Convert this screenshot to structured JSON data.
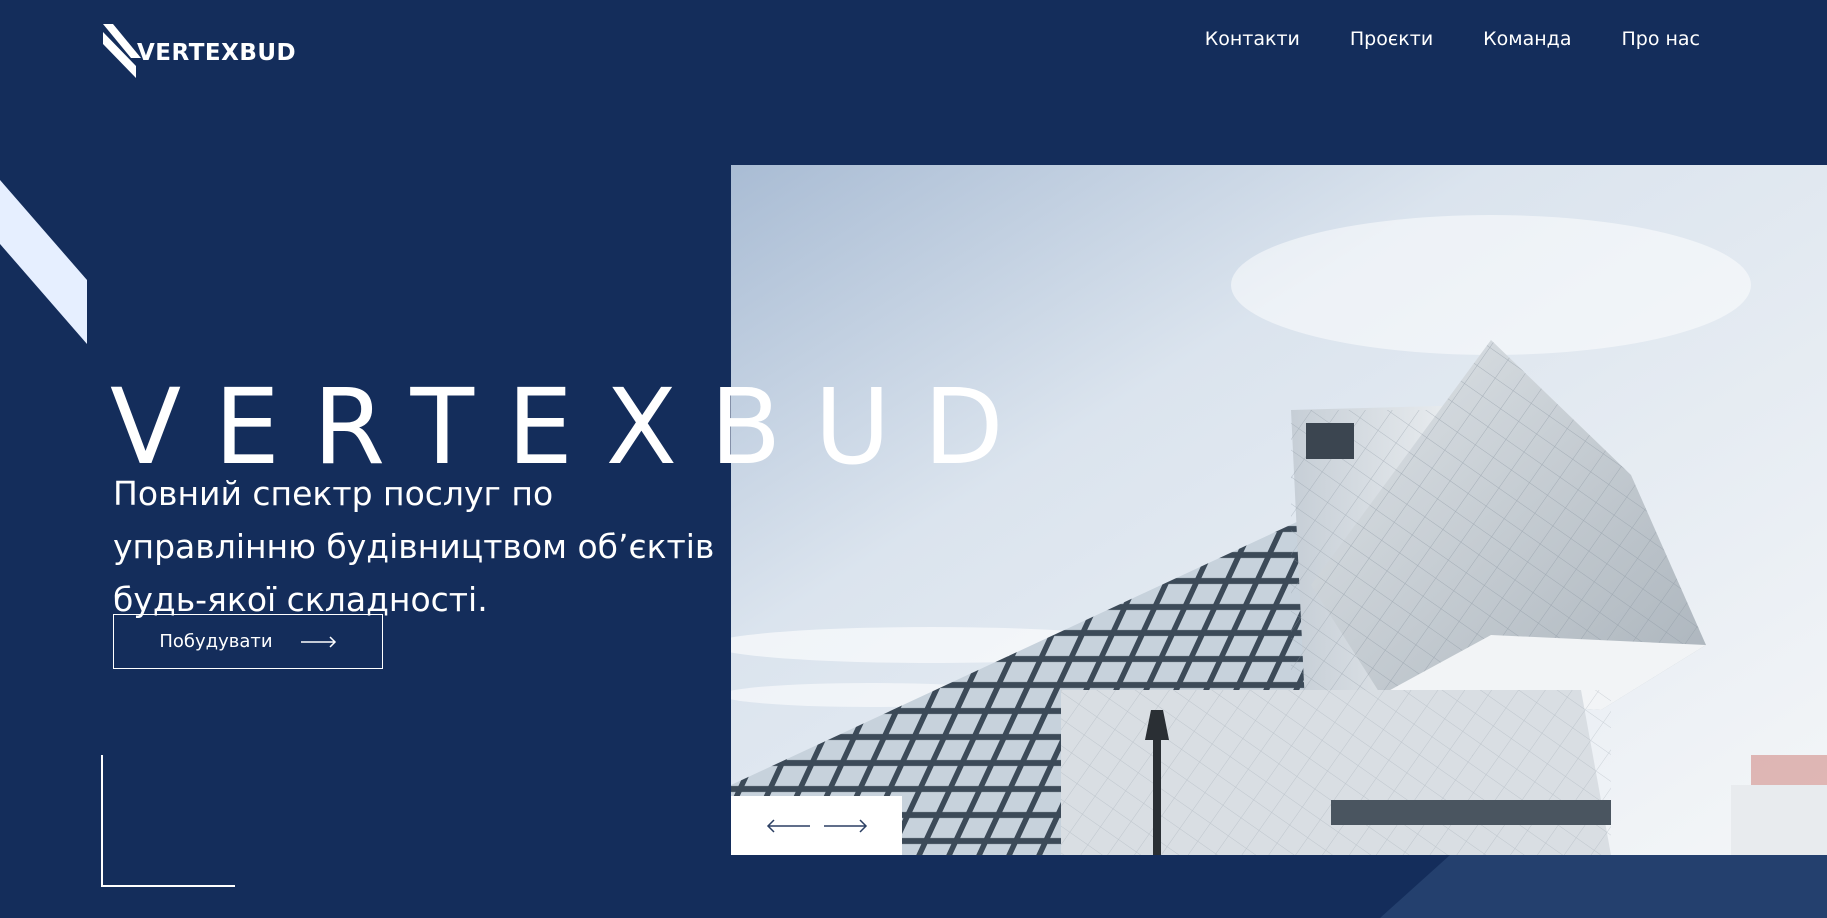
{
  "brand": {
    "logo_text": "VERTEXBUD"
  },
  "nav": {
    "items": [
      {
        "label": "Контакти"
      },
      {
        "label": "Проєкти"
      },
      {
        "label": "Команда"
      },
      {
        "label": "Про нас"
      }
    ]
  },
  "hero": {
    "title": "VERTEXBUD",
    "subtitle": "Повний спектр послуг по управлінню будівництвом об’єктів будь-якої складності.",
    "cta_label": "Побудувати",
    "cta_icon": "arrow-right-icon",
    "slider_prev_icon": "arrow-left-icon",
    "slider_next_icon": "arrow-right-icon",
    "image_subject": "building-photo"
  },
  "colors": {
    "background": "#142d5b",
    "text": "#ffffff",
    "accent_light": "#e6efff"
  }
}
